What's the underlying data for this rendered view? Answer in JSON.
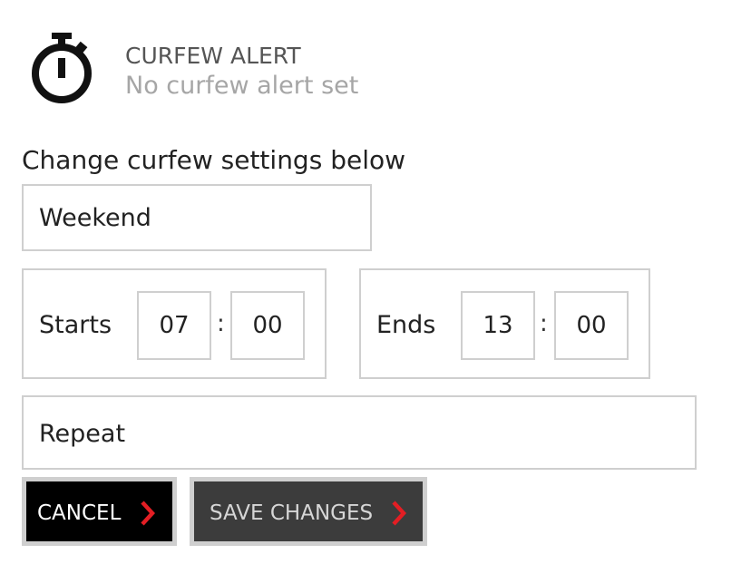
{
  "header": {
    "icon": "stopwatch-icon",
    "title": "CURFEW ALERT",
    "status": "No curfew alert set"
  },
  "instructions": "Change curfew settings below",
  "day_select": {
    "value": "Weekend"
  },
  "start_time": {
    "label": "Starts",
    "hour": "07",
    "separator": ":",
    "minute": "00"
  },
  "end_time": {
    "label": "Ends",
    "hour": "13",
    "separator": ":",
    "minute": "00"
  },
  "repeat_select": {
    "value": "Repeat"
  },
  "buttons": {
    "cancel_label": "CANCEL",
    "save_label": "SAVE CHANGES"
  },
  "colors": {
    "accent": "#e31e24",
    "cancel_bg": "#000000",
    "save_bg": "#3c3c3c",
    "border": "#cfcfcf"
  }
}
